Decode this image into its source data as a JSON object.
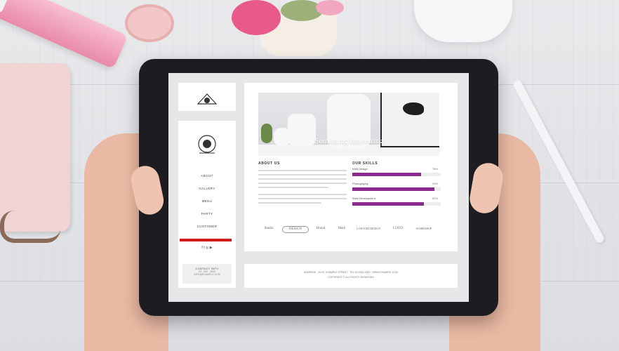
{
  "screen": {
    "sidebar": {
      "nav_items": [
        "ABOUT",
        "GALLERY",
        "MENU",
        "PARTY",
        "CUSTOMER"
      ],
      "social_icons": [
        "facebook-icon",
        "twitter-icon",
        "instagram-icon",
        "youtube-icon"
      ],
      "social_glyphs": "f  t  ◎  ▶",
      "contact": {
        "title": "CONTACT INFO",
        "lines": [
          "03 - 000 - 0000",
          "INFO@EXAMPLE.COM"
        ]
      }
    },
    "main": {
      "hero_title": "Something Interesting",
      "about": {
        "title": "ABOUT US",
        "line_count": 10
      },
      "skills": {
        "title": "OUR SKILLS",
        "items": [
          {
            "label": "Web Design",
            "value": "78%",
            "fill": 0.78
          },
          {
            "label": "Photography",
            "value": "93%",
            "fill": 0.93
          },
          {
            "label": "Web Development",
            "value": "81%",
            "fill": 0.81
          }
        ]
      },
      "logos": [
        "Studio",
        "DESIGN",
        "Brand",
        "Mark",
        "LOW END DESIGN",
        "LOGO",
        "WORKSHOP"
      ]
    },
    "footer": {
      "line1": "ADDRESS · 00-00, EXAMPLE STREET · TEL 00-0000-0000 · WWW.EXAMPLE.COM",
      "line2": "COPYRIGHT © ALL RIGHTS RESERVED"
    },
    "colors": {
      "accent": "#d41b1b",
      "skill_bar": "#8a2b8d",
      "bezel": "#1c1c21"
    }
  }
}
